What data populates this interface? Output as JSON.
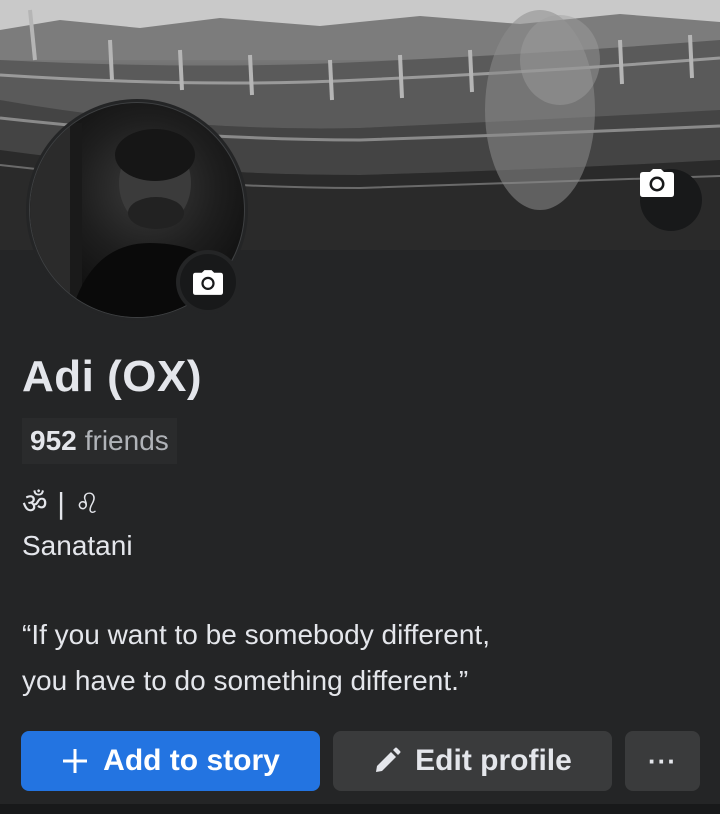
{
  "profile": {
    "name": "Adi (OX)",
    "friends_count": "952",
    "friends_label": "friends",
    "bio_line1": "ॐ | ♌",
    "bio_line2": "Sanatani",
    "quote_line1": "“If you want to be somebody different,",
    "quote_line2": "you have to do something different.”"
  },
  "icons": {
    "cover_camera": "camera-icon",
    "avatar_camera": "camera-icon",
    "add_story": "plus-icon",
    "edit_profile": "pencil-icon",
    "more": "more-dots-icon"
  },
  "actions": {
    "add_story_label": "Add to story",
    "edit_profile_label": "Edit profile",
    "more_label": "···"
  },
  "colors": {
    "background": "#242526",
    "primary_button": "#2374e1",
    "secondary_button": "#3a3b3c",
    "text_primary": "#e4e6eb",
    "text_secondary": "#b0b3b8"
  }
}
